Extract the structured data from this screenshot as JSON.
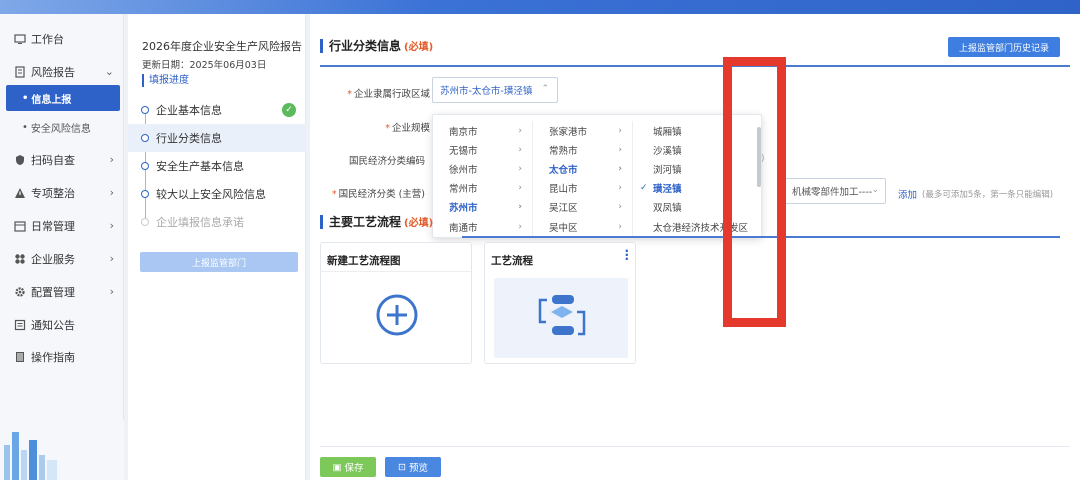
{
  "sidebar": {
    "items": [
      {
        "label": "工作台",
        "icon": "monitor-icon"
      },
      {
        "label": "风险报告",
        "icon": "report-icon"
      },
      {
        "label": "扫码自查",
        "icon": "shield-icon"
      },
      {
        "label": "专项整治",
        "icon": "warning-icon"
      },
      {
        "label": "日常管理",
        "icon": "calendar-icon"
      },
      {
        "label": "企业服务",
        "icon": "grid-icon"
      },
      {
        "label": "配置管理",
        "icon": "gear-icon"
      },
      {
        "label": "通知公告",
        "icon": "notice-icon"
      },
      {
        "label": "操作指南",
        "icon": "book-icon"
      }
    ],
    "sub_items": [
      {
        "label": "信息上报",
        "active": true
      },
      {
        "label": "安全风险信息",
        "active": false
      }
    ]
  },
  "steps_panel": {
    "report_title": "2026年度企业安全生产风险报告",
    "update_date": "更新日期：2025年06月03日",
    "fill_progress": "填报进度",
    "steps": [
      {
        "label": "企业基本信息",
        "done": true
      },
      {
        "label": "行业分类信息",
        "active": true
      },
      {
        "label": "安全生产基本信息"
      },
      {
        "label": "较大以上安全风险信息"
      },
      {
        "label": "企业填报信息承诺",
        "disabled": true
      }
    ],
    "submit_label": "上报监管部门"
  },
  "main": {
    "industry_section": {
      "title": "行业分类信息",
      "required": "(必填)"
    },
    "history_button": "上报监管部门历史记录",
    "fields": {
      "region_label": "企业隶属行政区域",
      "region_value": "苏州市-太仓市-璜泾镇",
      "scale_label": "企业规模",
      "econ_code_label": "国民经济分类编码",
      "econ_main_label": "国民经济分类 (主营)",
      "econ_value": "机械零部件加工----",
      "add_link": "添加",
      "add_hint": "(最多可添加5条，第一条只能编辑)",
      "hidden_frag": ")"
    },
    "cascader": {
      "col1": [
        {
          "label": "南京市"
        },
        {
          "label": "无锡市"
        },
        {
          "label": "徐州市"
        },
        {
          "label": "常州市"
        },
        {
          "label": "苏州市",
          "selected": true
        },
        {
          "label": "南通市"
        }
      ],
      "col2": [
        {
          "label": "张家港市"
        },
        {
          "label": "常熟市"
        },
        {
          "label": "太仓市",
          "selected": true
        },
        {
          "label": "昆山市"
        },
        {
          "label": "吴江区"
        },
        {
          "label": "吴中区"
        }
      ],
      "col3": [
        {
          "label": "城厢镇"
        },
        {
          "label": "沙溪镇"
        },
        {
          "label": "浏河镇"
        },
        {
          "label": "璜泾镇",
          "selected": true
        },
        {
          "label": "双凤镇"
        },
        {
          "label": "太仓港经济技术开发区"
        }
      ]
    },
    "process_section": {
      "title": "主要工艺流程",
      "required": "(必填)"
    },
    "cards": [
      {
        "title": "新建工艺流程图"
      },
      {
        "title": "工艺流程"
      }
    ],
    "save_label": "保存",
    "preview_label": "预览"
  },
  "colors": {
    "accent": "#2f62c9",
    "annotation": "#e4392c",
    "save": "#7cc95a"
  }
}
